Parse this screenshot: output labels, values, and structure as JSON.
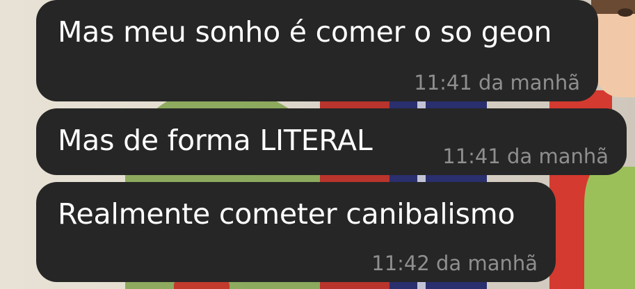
{
  "messages": [
    {
      "text": "Mas meu sonho é comer o so geon",
      "time": "11:41 da manhã"
    },
    {
      "text": "Mas de forma LITERAL",
      "time": "11:41 da manhã"
    },
    {
      "text": "Realmente cometer canibalismo",
      "time": "11:42 da manhã"
    }
  ],
  "colors": {
    "bubble": "#262626",
    "text": "#ffffff",
    "timestamp": "#8f8f8f"
  }
}
